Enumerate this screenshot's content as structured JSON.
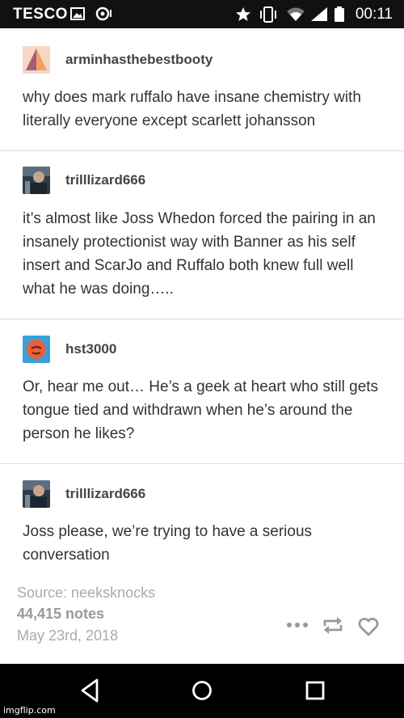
{
  "status_bar": {
    "carrier": "TESCO",
    "time": "00:11"
  },
  "posts": [
    {
      "username": "arminhasthebestbooty",
      "text": "why does mark ruffalo have insane chemistry with literally everyone except scarlett johansson"
    },
    {
      "username": "trilllizard666",
      "text": "it’s almost like Joss Whedon forced the pairing in an insanely protectionist way with Banner as his self insert and ScarJo and Ruffalo both knew full well what he was doing….."
    },
    {
      "username": "hst3000",
      "text": "Or, hear me out… He’s a geek at heart who still gets tongue tied and withdrawn when he’s around the person he likes?"
    },
    {
      "username": "trilllizard666",
      "text": "Joss please, we’re trying to have a serious conversation"
    }
  ],
  "footer": {
    "source": "Source: neeksknocks",
    "notes": "44,415 notes",
    "date": "May 23rd, 2018"
  },
  "watermark": "imgflip.com",
  "colors": {
    "status_bg": "#111111",
    "nav_bg": "#000000",
    "avatar_orange": "#e8743b",
    "avatar_blue": "#3aa0d8"
  }
}
